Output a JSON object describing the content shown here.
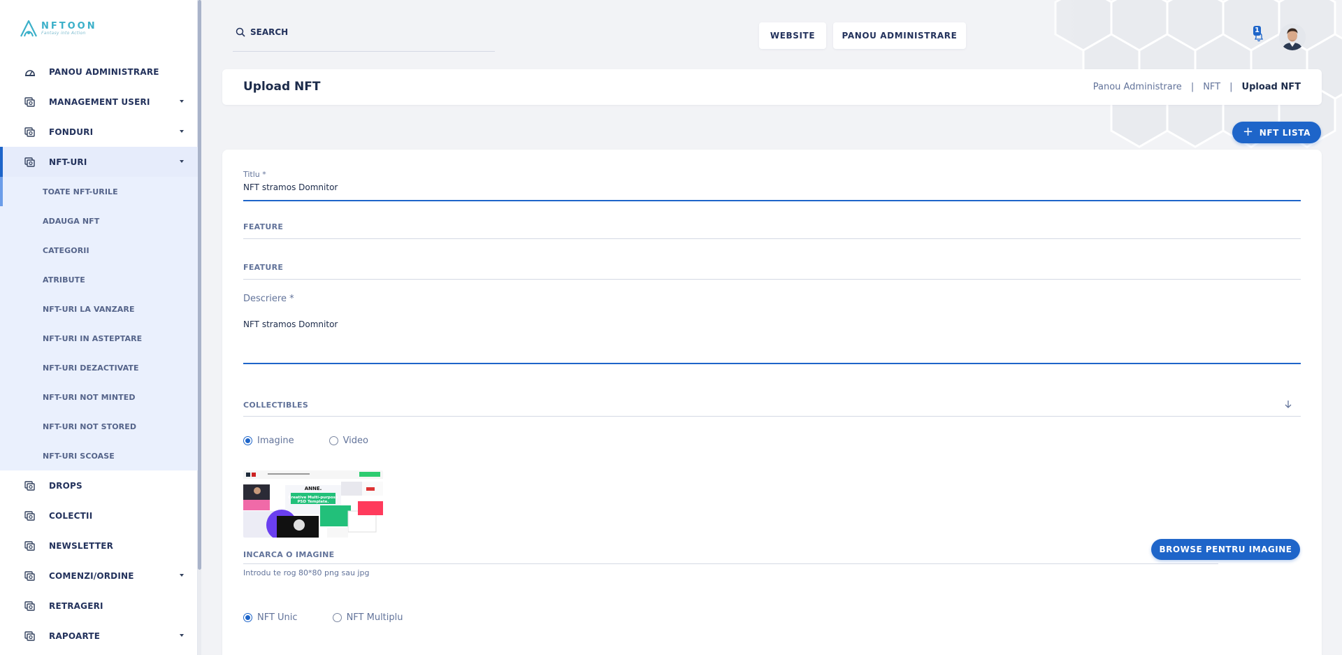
{
  "brand": {
    "name": "NFTOON",
    "tagline": "Fantasy into Action"
  },
  "sidebar": {
    "items": [
      {
        "label": "PANOU ADMINISTRARE",
        "icon": "dashboard-icon",
        "has_caret": false
      },
      {
        "label": "MANAGEMENT USERI",
        "icon": "layers-icon",
        "has_caret": true
      },
      {
        "label": "FONDURI",
        "icon": "layers-icon",
        "has_caret": true
      },
      {
        "label": "NFT-URI",
        "icon": "layers-icon",
        "has_caret": true,
        "active": true
      }
    ],
    "submenu": [
      "TOATE NFT-URILE",
      "ADAUGA NFT",
      "CATEGORII",
      "ATRIBUTE",
      "NFT-URI LA VANZARE",
      "NFT-URI IN ASTEPTARE",
      "NFT-URI DEZACTIVATE",
      "NFT-URI NOT MINTED",
      "NFT-URI NOT STORED",
      "NFT-URI SCOASE"
    ],
    "items_after": [
      {
        "label": "DROPS",
        "has_caret": false
      },
      {
        "label": "COLECTII",
        "has_caret": false
      },
      {
        "label": "NEWSLETTER",
        "has_caret": false
      },
      {
        "label": "COMENZI/ORDINE",
        "has_caret": true
      },
      {
        "label": "RETRAGERI",
        "has_caret": false
      },
      {
        "label": "RAPOARTE",
        "has_caret": true
      }
    ]
  },
  "topbar": {
    "search_placeholder": "SEARCH",
    "website_label": "WEBSITE",
    "panou_label": "PANOU ADMINISTRARE",
    "notification_count": "1"
  },
  "page": {
    "title": "Upload NFT",
    "breadcrumb": [
      "Panou Administrare",
      "NFT",
      "Upload NFT"
    ],
    "nft_lista_label": "NFT LISTA"
  },
  "form": {
    "titlu_label": "Titlu *",
    "titlu_value": "NFT stramos Domnitor",
    "feature1_label": "FEATURE",
    "feature2_label": "FEATURE",
    "descriere_label": "Descriere *",
    "descriere_value": "NFT stramos Domnitor",
    "collectibles_label": "COLLECTIBLES",
    "media_options": [
      "Imagine",
      "Video"
    ],
    "media_selected": "Imagine",
    "thumbnail_texts": [
      "ANNE.",
      "Creative Multi-purpose",
      "PSD Template."
    ],
    "upload_label": "INCARCA O IMAGINE",
    "browse_label": "BROWSE PENTRU IMAGINE",
    "upload_hint": "Introdu te rog 80*80 png sau jpg",
    "type_options": [
      "NFT Unic",
      "NFT Multiplu"
    ],
    "type_selected": "NFT Unic"
  },
  "colors": {
    "accent": "#1e65c9",
    "text": "#1c2b4a",
    "muted": "#62739a",
    "logo": "#3bb0c9"
  }
}
